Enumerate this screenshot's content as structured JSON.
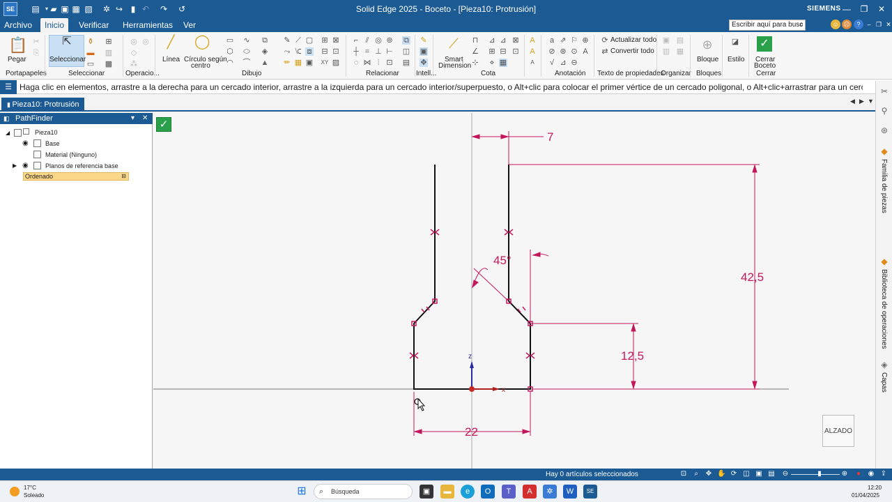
{
  "titlebar": {
    "app_logo": "SE",
    "title": "Solid Edge 2025 - Boceto - [Pieza10: Protrusión]",
    "brand": "SIEMENS",
    "quick_access_icons": [
      "new-icon",
      "open-icon",
      "save-icon",
      "save-as-icon",
      "print-icon",
      "options-icon",
      "redo-icon",
      "bookmark-icon",
      "undo-icon",
      "repeat-icon",
      "customize-icon"
    ],
    "window_buttons": [
      "minimize-icon",
      "restore-icon",
      "close-icon"
    ]
  },
  "menu": {
    "items": [
      "Archivo",
      "Inicio",
      "Verificar",
      "Herramientas",
      "Ver"
    ],
    "active": "Inicio",
    "search_placeholder": "Escribir aquí para busc"
  },
  "ribbon": {
    "groups": {
      "portapapeles": {
        "label": "Portapapeles",
        "paste": "Pegar"
      },
      "seleccionar": {
        "label": "Seleccionar",
        "select": "Seleccionar"
      },
      "operaciones": {
        "label": "Operacio..."
      },
      "dibujo": {
        "label": "Dibujo",
        "linea": "Línea",
        "circulo": "Círculo según",
        "circulo2": "centro"
      },
      "relacionar": {
        "label": "Relacionar"
      },
      "intelli": {
        "label": "Intell..."
      },
      "cota": {
        "label": "Cota",
        "smart": "Smart",
        "smart2": "Dimension"
      },
      "anotacion": {
        "label": "Anotación"
      },
      "propiedades": {
        "label": "Texto de propiedades",
        "actualizar": "Actualizar todo",
        "convertir": "Convertir todo"
      },
      "organizar": {
        "label": "Organizar"
      },
      "bloques": {
        "label": "Bloques",
        "bloque": "Bloque"
      },
      "estilo": {
        "label": "Estilo"
      },
      "cerrar": {
        "label": "Cerrar",
        "cerrar1": "Cerrar",
        "cerrar2": "Boceto"
      }
    }
  },
  "prompt": "Haga clic en elementos, arrastre a la derecha para un cercado interior, arrastre a la izquierda para un cercado interior/superpuesto, o Alt+clic para colocar el primer vértice de un cercado poligonal, o Alt+clic+arrastrar para un cercado de",
  "doc_tab": "Pieza10: Protrusión",
  "pathfinder": {
    "title": "PathFinder",
    "tree": [
      {
        "label": "Pieza10"
      },
      {
        "label": "Base"
      },
      {
        "label": "Material (Ninguno)"
      },
      {
        "label": "Planos de referencia base"
      }
    ],
    "ordered": "Ordenado"
  },
  "sketch": {
    "dimensions": {
      "top_offset": "7",
      "angle": "45°",
      "total_height": "42,5",
      "shoulder_height": "12,5",
      "base_width": "22"
    },
    "axes": {
      "z": "z",
      "x": "x"
    },
    "colors": {
      "dimension": "#c2185b",
      "geometry": "#111111",
      "axis_z": "#2a2aa0",
      "axis_x": "#b02020"
    },
    "view_label": "ALZADO"
  },
  "right_dock": {
    "tabs": [
      "Familia de piezas",
      "Biblioteca de operaciones",
      "Capas"
    ]
  },
  "status": {
    "text": "Hay 0 artículos seleccionados"
  },
  "taskbar": {
    "temperature": "17°C",
    "weather": "Soleado",
    "search": "Búsqueda",
    "time": "12:20",
    "date": "01/04/2025"
  }
}
